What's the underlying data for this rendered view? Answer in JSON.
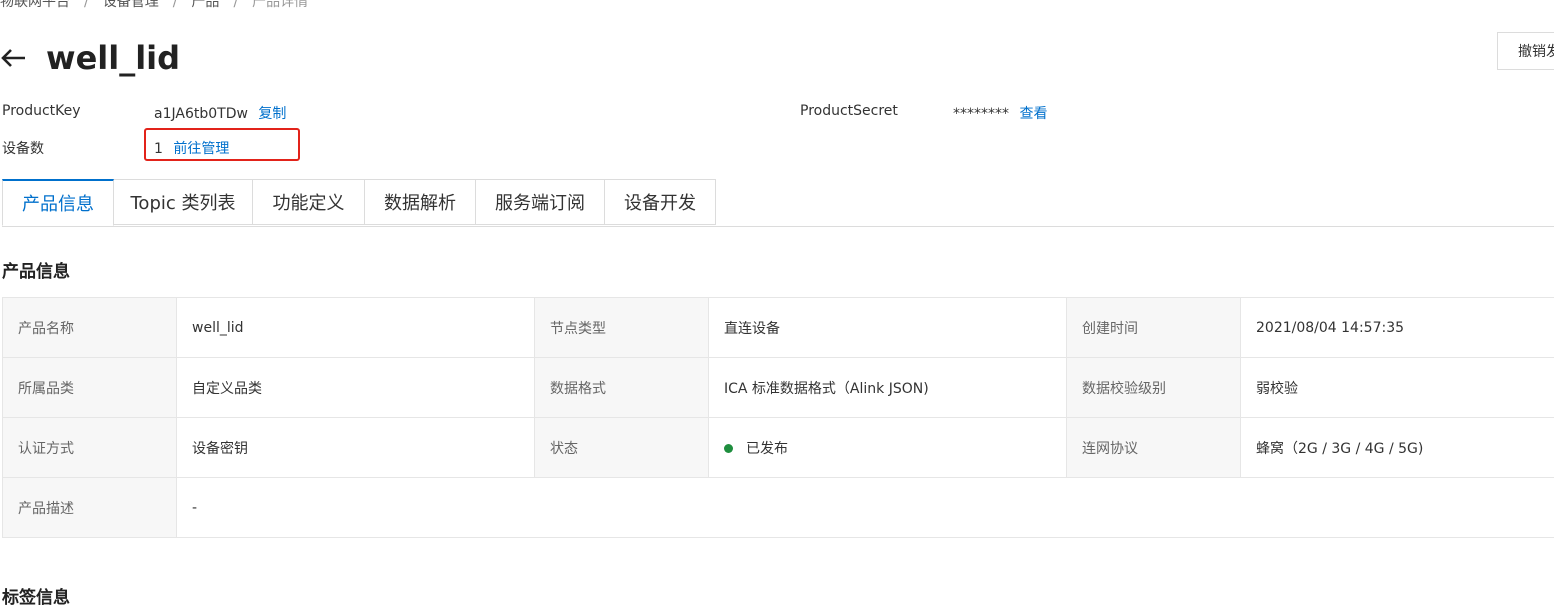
{
  "breadcrumb": {
    "items": [
      "物联网平台",
      "设备管理",
      "产品"
    ],
    "current": "产品详情",
    "separator": "/"
  },
  "header": {
    "back_icon": "arrow-left-icon",
    "title": "well_lid",
    "revoke_button_label": "撤销发"
  },
  "meta": {
    "product_key_label": "ProductKey",
    "product_key_value": "a1JA6tb0TDw",
    "copy_link": "复制",
    "product_secret_label": "ProductSecret",
    "product_secret_value": "********",
    "view_link": "查看",
    "device_count_label": "设备数",
    "device_count_value": "1",
    "manage_link": "前往管理"
  },
  "tabs": [
    {
      "label": "产品信息",
      "active": true
    },
    {
      "label": "Topic 类列表",
      "active": false
    },
    {
      "label": "功能定义",
      "active": false
    },
    {
      "label": "数据解析",
      "active": false
    },
    {
      "label": "服务端订阅",
      "active": false
    },
    {
      "label": "设备开发",
      "active": false
    }
  ],
  "product_info": {
    "section_title": "产品信息",
    "rows": [
      [
        {
          "key": "产品名称",
          "value": "well_lid"
        },
        {
          "key": "节点类型",
          "value": "直连设备"
        },
        {
          "key": "创建时间",
          "value": "2021/08/04 14:57:35"
        }
      ],
      [
        {
          "key": "所属品类",
          "value": "自定义品类"
        },
        {
          "key": "数据格式",
          "value": "ICA 标准数据格式（Alink JSON)"
        },
        {
          "key": "数据校验级别",
          "value": "弱校验"
        }
      ],
      [
        {
          "key": "认证方式",
          "value": "设备密钥"
        },
        {
          "key": "状态",
          "value": "已发布",
          "status_color": "#1e8e3e"
        },
        {
          "key": "连网协议",
          "value": "蜂窝（2G / 3G / 4G / 5G)"
        }
      ]
    ],
    "description_label": "产品描述",
    "description_value": "-"
  },
  "tag_info": {
    "section_title": "标签信息"
  },
  "colors": {
    "accent": "#0070cc",
    "highlight": "#e2231a",
    "status_published": "#1e8e3e"
  }
}
